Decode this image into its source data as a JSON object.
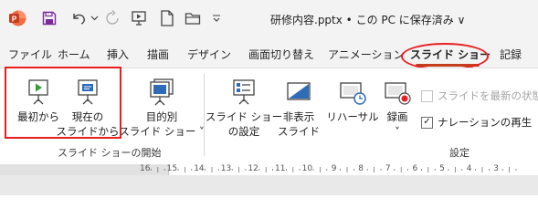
{
  "titlebar": {
    "icons": [
      "powerpoint-logo-icon",
      "save-icon",
      "undo-icon",
      "chevron-down-icon",
      "redo-icon",
      "present-icon",
      "new-file-icon",
      "folder-icon",
      "more-icon"
    ],
    "title": "研修内容.pptx • この PC に保存済み ∨"
  },
  "tabs": [
    {
      "label": "ファイル",
      "active": false
    },
    {
      "label": "ホーム",
      "active": false
    },
    {
      "label": "挿入",
      "active": false
    },
    {
      "label": "描画",
      "active": false
    },
    {
      "label": "デザイン",
      "active": false
    },
    {
      "label": "画面切り替え",
      "active": false
    },
    {
      "label": "アニメーション",
      "active": false
    },
    {
      "label": "スライド ショー",
      "active": true
    },
    {
      "label": "記録",
      "active": false
    }
  ],
  "ribbon": {
    "start_group": {
      "label": "スライド ショーの開始",
      "from_beginning": "最初から",
      "from_current_1": "現在の",
      "from_current_2": "スライドから",
      "custom_1": "目的別",
      "custom_2": "スライド ショー ˅"
    },
    "setup_group": {
      "label": "設定",
      "setup_1": "スライド ショー",
      "setup_2": "の設定",
      "hide_1": "非表示",
      "hide_2": "スライド",
      "rehearse": "リハーサル",
      "record_1": "録画",
      "record_2": "˅",
      "keep_updated": "スライドを最新の状態に",
      "keep_updated_checked": false,
      "narration": "ナレーションの再生",
      "narration_checked": true
    }
  },
  "ruler": {
    "numbers": [
      "16",
      "15",
      "14",
      "13",
      "12",
      "11",
      "10",
      "9",
      "8",
      "7",
      "6",
      "5",
      "4",
      "3"
    ]
  },
  "colors": {
    "accent": "#c43e1c",
    "highlight": "#e81f1f",
    "icon_blue": "#2e6bb8"
  }
}
